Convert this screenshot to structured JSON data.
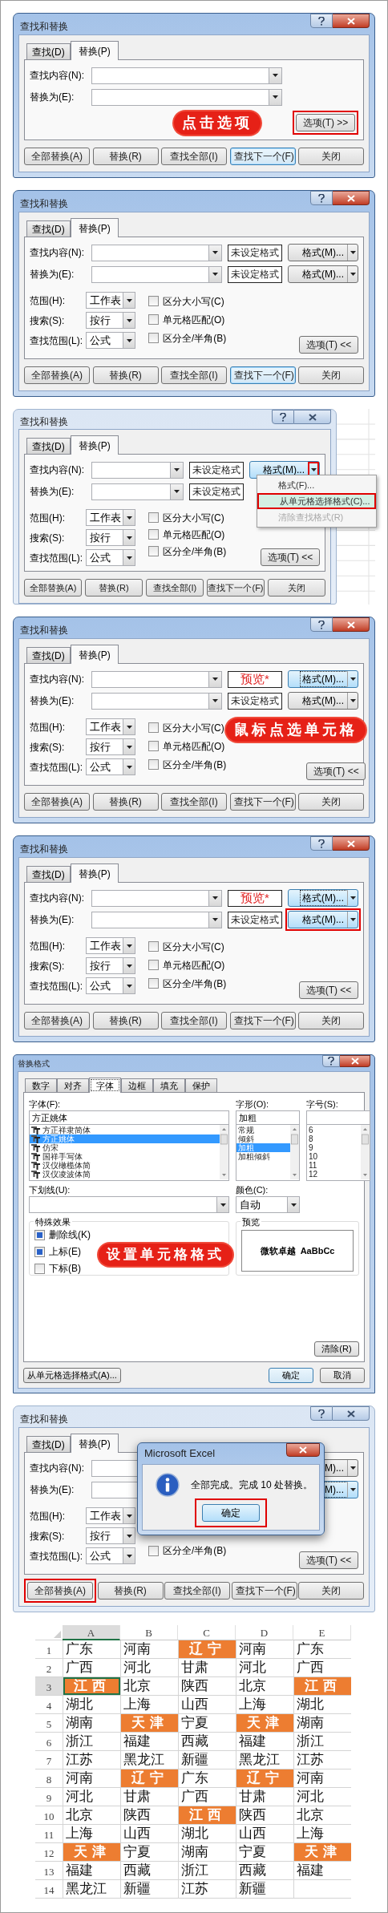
{
  "panels": [
    {
      "kind": "find_replace",
      "title": "查找和替换",
      "active": true,
      "tabs": [
        {
          "label": "查找(D)",
          "selected": false
        },
        {
          "label": "替换(P)",
          "selected": true
        }
      ],
      "fields": [
        {
          "label": "查找内容(N):"
        },
        {
          "label": "替换为(E):"
        }
      ],
      "callout": "点击选项",
      "options_button": {
        "label": "选项(T) >>",
        "highlighted": true
      },
      "buttons": [
        {
          "label": "全部替换(A)",
          "default": false,
          "highlighted": false
        },
        {
          "label": "替换(R)",
          "default": false,
          "highlighted": false
        },
        {
          "label": "查找全部(I)",
          "default": false,
          "highlighted": false
        },
        {
          "label": "查找下一个(F)",
          "default": true,
          "highlighted": false
        },
        {
          "label": "关闭",
          "default": false,
          "highlighted": false
        }
      ]
    },
    {
      "kind": "find_replace",
      "title": "查找和替换",
      "active": true,
      "tabs": [
        {
          "label": "查找(D)",
          "selected": false
        },
        {
          "label": "替换(P)",
          "selected": true
        }
      ],
      "fields": [
        {
          "label": "查找内容(N):",
          "format_preview": {
            "kind": "unset",
            "text": "未设定格式"
          },
          "format_button": {
            "label": "格式(M)...",
            "focused": false,
            "highlighted": false,
            "arrow_highlighted": false
          }
        },
        {
          "label": "替换为(E):",
          "format_preview": {
            "kind": "unset",
            "text": "未设定格式"
          },
          "format_button": {
            "label": "格式(M)...",
            "focused": false,
            "highlighted": false,
            "arrow_highlighted": false
          }
        }
      ],
      "options": {
        "scope": [
          {
            "label": "范围(H):",
            "value": "工作表"
          },
          {
            "label": "搜索(S):",
            "value": "按行"
          },
          {
            "label": "查找范围(L):",
            "value": "公式"
          }
        ],
        "checkboxes": [
          {
            "label": "区分大小写(C)",
            "checked": false
          },
          {
            "label": "单元格匹配(O)",
            "checked": false
          },
          {
            "label": "区分全/半角(B)",
            "checked": false
          }
        ]
      },
      "options_button": {
        "label": "选项(T) <<",
        "highlighted": false
      },
      "buttons": [
        {
          "label": "全部替换(A)",
          "default": false,
          "highlighted": false
        },
        {
          "label": "替换(R)",
          "default": false,
          "highlighted": false
        },
        {
          "label": "查找全部(I)",
          "default": false,
          "highlighted": false
        },
        {
          "label": "查找下一个(F)",
          "default": true,
          "highlighted": false
        },
        {
          "label": "关闭",
          "default": false,
          "highlighted": false
        }
      ]
    },
    {
      "kind": "find_replace",
      "title": "查找和替换",
      "active": false,
      "tabs": [
        {
          "label": "查找(D)",
          "selected": false
        },
        {
          "label": "替换(P)",
          "selected": true
        }
      ],
      "fields": [
        {
          "label": "查找内容(N):",
          "format_preview": {
            "kind": "unset",
            "text": "未设定格式"
          },
          "format_button": {
            "label": "格式(M)...",
            "focused": true,
            "highlighted": false,
            "arrow_highlighted": true
          }
        },
        {
          "label": "替换为(E):",
          "format_preview": {
            "kind": "unset",
            "text": "未设定格式"
          }
        }
      ],
      "menu": [
        {
          "label": "格式(F)...",
          "highlighted": false,
          "disabled": false
        },
        {
          "label": "从单元格选择格式(C)...",
          "highlighted": true,
          "disabled": false
        },
        {
          "label": "清除查找格式(R)",
          "highlighted": false,
          "disabled": true
        }
      ],
      "options": {
        "scope": [
          {
            "label": "范围(H):",
            "value": "工作表"
          },
          {
            "label": "搜索(S):",
            "value": "按行"
          },
          {
            "label": "查找范围(L):",
            "value": "公式"
          }
        ],
        "checkboxes": [
          {
            "label": "区分大小写(C)",
            "checked": false
          },
          {
            "label": "单元格匹配(O)",
            "checked": false
          },
          {
            "label": "区分全/半角(B)",
            "checked": false
          }
        ]
      },
      "options_button": {
        "label": "选项(T) <<",
        "highlighted": false
      },
      "buttons": [
        {
          "label": "全部替换(A)",
          "default": false,
          "highlighted": false
        },
        {
          "label": "替换(R)",
          "default": false,
          "highlighted": false
        },
        {
          "label": "查找全部(I)",
          "default": false,
          "highlighted": false
        },
        {
          "label": "查找下一个(F)",
          "default": false,
          "highlighted": false
        },
        {
          "label": "关闭",
          "default": false,
          "highlighted": false
        }
      ]
    },
    {
      "kind": "find_replace",
      "title": "查找和替换",
      "active": true,
      "tabs": [
        {
          "label": "查找(D)",
          "selected": false
        },
        {
          "label": "替换(P)",
          "selected": true
        }
      ],
      "fields": [
        {
          "label": "查找内容(N):",
          "format_preview": {
            "kind": "sample",
            "text": "预览*"
          },
          "format_button": {
            "label": "格式(M)...",
            "focused": true,
            "highlighted": false,
            "arrow_highlighted": false
          }
        },
        {
          "label": "替换为(E):",
          "format_preview": {
            "kind": "unset",
            "text": "未设定格式"
          },
          "format_button": {
            "label": "格式(M)...",
            "focused": false,
            "highlighted": false,
            "arrow_highlighted": false
          }
        }
      ],
      "callout": "鼠标点选单元格",
      "options": {
        "scope": [
          {
            "label": "范围(H):",
            "value": "工作表"
          },
          {
            "label": "搜索(S):",
            "value": "按行"
          },
          {
            "label": "查找范围(L):",
            "value": "公式"
          }
        ],
        "checkboxes": [
          {
            "label": "区分大小写(C)",
            "checked": false
          },
          {
            "label": "单元格匹配(O)",
            "checked": false
          },
          {
            "label": "区分全/半角(B)",
            "checked": false
          }
        ]
      },
      "options_button": {
        "label": "选项(T) <<",
        "highlighted": false
      },
      "buttons": [
        {
          "label": "全部替换(A)",
          "default": false,
          "highlighted": false
        },
        {
          "label": "替换(R)",
          "default": false,
          "highlighted": false
        },
        {
          "label": "查找全部(I)",
          "default": false,
          "highlighted": false
        },
        {
          "label": "查找下一个(F)",
          "default": false,
          "highlighted": false
        },
        {
          "label": "关闭",
          "default": false,
          "highlighted": false
        }
      ]
    },
    {
      "kind": "find_replace",
      "title": "查找和替换",
      "active": true,
      "tabs": [
        {
          "label": "查找(D)",
          "selected": false
        },
        {
          "label": "替换(P)",
          "selected": true
        }
      ],
      "fields": [
        {
          "label": "查找内容(N):",
          "format_preview": {
            "kind": "sample",
            "text": "预览*"
          },
          "format_button": {
            "label": "格式(M)...",
            "focused": true,
            "highlighted": false,
            "arrow_highlighted": false
          }
        },
        {
          "label": "替换为(E):",
          "format_preview": {
            "kind": "unset",
            "text": "未设定格式"
          },
          "format_button": {
            "label": "格式(M)...",
            "focused": false,
            "highlighted": true,
            "arrow_highlighted": false
          }
        }
      ],
      "options": {
        "scope": [
          {
            "label": "范围(H):",
            "value": "工作表"
          },
          {
            "label": "搜索(S):",
            "value": "按行"
          },
          {
            "label": "查找范围(L):",
            "value": "公式"
          }
        ],
        "checkboxes": [
          {
            "label": "区分大小写(C)",
            "checked": false
          },
          {
            "label": "单元格匹配(O)",
            "checked": false
          },
          {
            "label": "区分全/半角(B)",
            "checked": false
          }
        ]
      },
      "options_button": {
        "label": "选项(T) <<",
        "highlighted": false
      },
      "buttons": [
        {
          "label": "全部替换(A)",
          "default": false,
          "highlighted": false
        },
        {
          "label": "替换(R)",
          "default": false,
          "highlighted": false
        },
        {
          "label": "查找全部(I)",
          "default": false,
          "highlighted": false
        },
        {
          "label": "查找下一个(F)",
          "default": false,
          "highlighted": false
        },
        {
          "label": "关闭",
          "default": false,
          "highlighted": false
        }
      ]
    },
    {
      "kind": "format",
      "title": "替换格式",
      "active": true,
      "tabs": [
        {
          "label": "数字",
          "selected": false
        },
        {
          "label": "对齐",
          "selected": false
        },
        {
          "label": "字体",
          "selected": true
        },
        {
          "label": "边框",
          "selected": false
        },
        {
          "label": "填充",
          "selected": false
        },
        {
          "label": "保护",
          "selected": false
        }
      ],
      "font": {
        "label": "字体(F):",
        "value": "方正姚体",
        "items": [
          {
            "label": "方正祥隶简体",
            "selected": false
          },
          {
            "label": "方正姚体",
            "selected": true
          },
          {
            "label": "仿宋",
            "selected": false
          },
          {
            "label": "国祥手写体",
            "selected": false
          },
          {
            "label": "汉仪橄榄体简",
            "selected": false
          },
          {
            "label": "汉仪凌波体简",
            "selected": false
          }
        ]
      },
      "style": {
        "label": "字形(O):",
        "value": "加粗",
        "items": [
          {
            "label": "常规",
            "selected": false
          },
          {
            "label": "倾斜",
            "selected": false
          },
          {
            "label": "加粗",
            "selected": true
          },
          {
            "label": "加粗倾斜",
            "selected": false
          }
        ]
      },
      "size": {
        "label": "字号(S):",
        "items": [
          {
            "label": "6",
            "selected": false
          },
          {
            "label": "8",
            "selected": false
          },
          {
            "label": "9",
            "selected": false
          },
          {
            "label": "10",
            "selected": false
          },
          {
            "label": "11",
            "selected": false
          },
          {
            "label": "12",
            "selected": false
          }
        ]
      },
      "underline": {
        "label": "下划线(U):"
      },
      "color": {
        "label": "颜色(C):",
        "value": "自动"
      },
      "effects": {
        "title": "特殊效果",
        "items": [
          {
            "label": "删除线(K)",
            "checked": true
          },
          {
            "label": "上标(E)",
            "checked": true
          },
          {
            "label": "下标(B)",
            "checked": false
          }
        ]
      },
      "preview": {
        "title": "预览",
        "sample": "微软卓越  AaBbCc"
      },
      "callout": "设置单元格格式",
      "clear_button": "清除(R)",
      "pick_button": "从单元格选择格式(A)...",
      "buttons": [
        {
          "label": "确定",
          "default": true
        },
        {
          "label": "取消",
          "default": false
        }
      ]
    },
    {
      "kind": "find_replace",
      "title": "查找和替换",
      "active": false,
      "tabs": [
        {
          "label": "查找(D)",
          "selected": false
        },
        {
          "label": "替换(P)",
          "selected": true
        }
      ],
      "fields": [
        {
          "label": "查找内容(N):",
          "format_button": {
            "label": "M)...",
            "focused": false,
            "highlighted": false,
            "arrow_highlighted": false
          }
        },
        {
          "label": "替换为(E):",
          "format_button": {
            "label": "M)...",
            "focused": true,
            "highlighted": false,
            "arrow_highlighted": false
          }
        }
      ],
      "options": {
        "scope": [
          {
            "label": "范围(H):",
            "value": "工作表"
          },
          {
            "label": "搜索(S):",
            "value": "按行"
          },
          {
            "label": "查找范围(L):",
            "value": "公式"
          }
        ],
        "checkboxes": [
          {
            "label": "区分全/半角(B)",
            "checked": false
          }
        ]
      },
      "options_button": {
        "label": "选项(T) <<",
        "highlighted": false
      },
      "message_box": {
        "title": "Microsoft Excel",
        "text": "全部完成。完成 10 处替换。",
        "button": {
          "label": "确定",
          "highlighted": true
        }
      },
      "buttons": [
        {
          "label": "全部替换(A)",
          "default": false,
          "highlighted": true
        },
        {
          "label": "替换(R)",
          "default": false,
          "highlighted": false
        },
        {
          "label": "查找全部(I)",
          "default": false,
          "highlighted": false
        },
        {
          "label": "查找下一个(F)",
          "default": false,
          "highlighted": false
        },
        {
          "label": "关闭",
          "default": false,
          "highlighted": false
        }
      ]
    },
    {
      "kind": "sheet",
      "columns": [
        {
          "label": "A",
          "selected": true
        },
        {
          "label": "B",
          "selected": false
        },
        {
          "label": "C",
          "selected": false
        },
        {
          "label": "D",
          "selected": false
        },
        {
          "label": "E",
          "selected": false
        }
      ],
      "rows": [
        {
          "number": "1",
          "selected": false,
          "cells": [
            {
              "text": "广东",
              "highlighted": false
            },
            {
              "text": "河南",
              "highlighted": false
            },
            {
              "text": "辽宁",
              "highlighted": true
            },
            {
              "text": "河南",
              "highlighted": false
            },
            {
              "text": "广东",
              "highlighted": false
            }
          ]
        },
        {
          "number": "2",
          "selected": false,
          "cells": [
            {
              "text": "广西",
              "highlighted": false
            },
            {
              "text": "河北",
              "highlighted": false
            },
            {
              "text": "甘肃",
              "highlighted": false
            },
            {
              "text": "河北",
              "highlighted": false
            },
            {
              "text": "广西",
              "highlighted": false
            }
          ]
        },
        {
          "number": "3",
          "selected": true,
          "cells": [
            {
              "text": "江西",
              "highlighted": true
            },
            {
              "text": "北京",
              "highlighted": false
            },
            {
              "text": "陕西",
              "highlighted": false
            },
            {
              "text": "北京",
              "highlighted": false
            },
            {
              "text": "江西",
              "highlighted": true
            }
          ]
        },
        {
          "number": "4",
          "selected": false,
          "cells": [
            {
              "text": "湖北",
              "highlighted": false
            },
            {
              "text": "上海",
              "highlighted": false
            },
            {
              "text": "山西",
              "highlighted": false
            },
            {
              "text": "上海",
              "highlighted": false
            },
            {
              "text": "湖北",
              "highlighted": false
            }
          ]
        },
        {
          "number": "5",
          "selected": false,
          "cells": [
            {
              "text": "湖南",
              "highlighted": false
            },
            {
              "text": "天津",
              "highlighted": true
            },
            {
              "text": "宁夏",
              "highlighted": false
            },
            {
              "text": "天津",
              "highlighted": true
            },
            {
              "text": "湖南",
              "highlighted": false
            }
          ]
        },
        {
          "number": "6",
          "selected": false,
          "cells": [
            {
              "text": "浙江",
              "highlighted": false
            },
            {
              "text": "福建",
              "highlighted": false
            },
            {
              "text": "西藏",
              "highlighted": false
            },
            {
              "text": "福建",
              "highlighted": false
            },
            {
              "text": "浙江",
              "highlighted": false
            }
          ]
        },
        {
          "number": "7",
          "selected": false,
          "cells": [
            {
              "text": "江苏",
              "highlighted": false
            },
            {
              "text": "黑龙江",
              "highlighted": false
            },
            {
              "text": "新疆",
              "highlighted": false
            },
            {
              "text": "黑龙江",
              "highlighted": false
            },
            {
              "text": "江苏",
              "highlighted": false
            }
          ]
        },
        {
          "number": "8",
          "selected": false,
          "cells": [
            {
              "text": "河南",
              "highlighted": false
            },
            {
              "text": "辽宁",
              "highlighted": true
            },
            {
              "text": "广东",
              "highlighted": false
            },
            {
              "text": "辽宁",
              "highlighted": true
            },
            {
              "text": "河南",
              "highlighted": false
            }
          ]
        },
        {
          "number": "9",
          "selected": false,
          "cells": [
            {
              "text": "河北",
              "highlighted": false
            },
            {
              "text": "甘肃",
              "highlighted": false
            },
            {
              "text": "广西",
              "highlighted": false
            },
            {
              "text": "甘肃",
              "highlighted": false
            },
            {
              "text": "河北",
              "highlighted": false
            }
          ]
        },
        {
          "number": "10",
          "selected": false,
          "cells": [
            {
              "text": "北京",
              "highlighted": false
            },
            {
              "text": "陕西",
              "highlighted": false
            },
            {
              "text": "江西",
              "highlighted": true
            },
            {
              "text": "陕西",
              "highlighted": false
            },
            {
              "text": "北京",
              "highlighted": false
            }
          ]
        },
        {
          "number": "11",
          "selected": false,
          "cells": [
            {
              "text": "上海",
              "highlighted": false
            },
            {
              "text": "山西",
              "highlighted": false
            },
            {
              "text": "湖北",
              "highlighted": false
            },
            {
              "text": "山西",
              "highlighted": false
            },
            {
              "text": "上海",
              "highlighted": false
            }
          ]
        },
        {
          "number": "12",
          "selected": false,
          "cells": [
            {
              "text": "天津",
              "highlighted": true
            },
            {
              "text": "宁夏",
              "highlighted": false
            },
            {
              "text": "湖南",
              "highlighted": false
            },
            {
              "text": "宁夏",
              "highlighted": false
            },
            {
              "text": "天津",
              "highlighted": true
            }
          ]
        },
        {
          "number": "13",
          "selected": false,
          "cells": [
            {
              "text": "福建",
              "highlighted": false
            },
            {
              "text": "西藏",
              "highlighted": false
            },
            {
              "text": "浙江",
              "highlighted": false
            },
            {
              "text": "西藏",
              "highlighted": false
            },
            {
              "text": "福建",
              "highlighted": false
            }
          ]
        },
        {
          "number": "14",
          "selected": false,
          "cells": [
            {
              "text": "黑龙江",
              "highlighted": false
            },
            {
              "text": "新疆",
              "highlighted": false
            },
            {
              "text": "江苏",
              "highlighted": false
            },
            {
              "text": "新疆",
              "highlighted": false
            },
            {
              "highlighted": false
            }
          ]
        }
      ]
    }
  ]
}
